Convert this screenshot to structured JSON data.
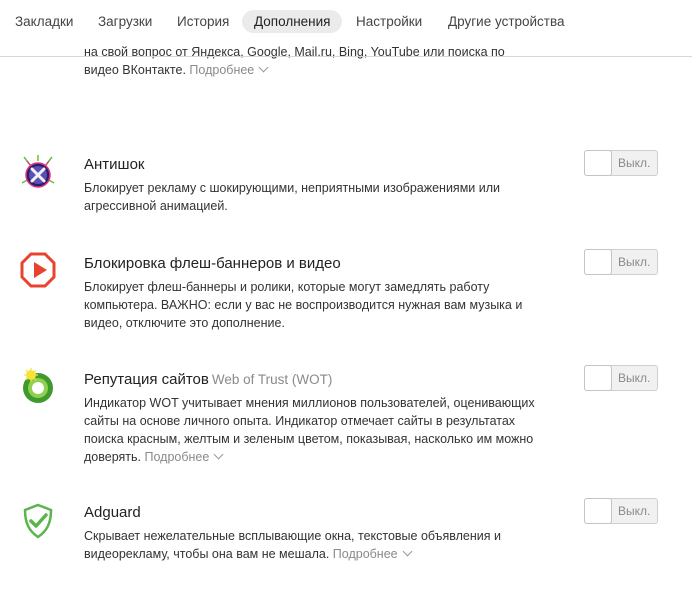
{
  "nav": {
    "tabs": [
      {
        "label": "Закладки",
        "active": false
      },
      {
        "label": "Загрузки",
        "active": false
      },
      {
        "label": "История",
        "active": false
      },
      {
        "label": "Дополнения",
        "active": true
      },
      {
        "label": "Настройки",
        "active": false
      },
      {
        "label": "Другие устройства",
        "active": false
      }
    ]
  },
  "previous_item": {
    "desc_line1": "на свой вопрос от Яндекса, Google, Mail.ru, Bing, YouTube или поиска по",
    "desc_line2": "видео ВКонтакте.",
    "more_label": "Подробнее"
  },
  "addons": [
    {
      "icon": "antishock-icon",
      "title": "Антишок",
      "subtitle": "",
      "description": "Блокирует рекламу с шокирующими, неприятными изображениями или агрессивной анимацией.",
      "more_label": "",
      "toggle_label": "Выкл.",
      "enabled": false
    },
    {
      "icon": "flash-block-icon",
      "title": "Блокировка флеш-баннеров и видео",
      "subtitle": "",
      "description": "Блокирует флеш-баннеры и ролики, которые могут замедлять работу компьютера. ВАЖНО: если у вас не воспроизводится нужная вам музыка и видео, отключите это дополнение.",
      "more_label": "",
      "toggle_label": "Выкл.",
      "enabled": false
    },
    {
      "icon": "wot-icon",
      "title": "Репутация сайтов",
      "subtitle": "Web of Trust (WOT)",
      "description": "Индикатор WOT учитывает мнения миллионов пользователей, оценивающих сайты на основе личного опыта. Индикатор отмечает сайты в результатах поиска красным, желтым и зеленым цветом, показывая, насколько им можно доверять.",
      "more_label": "Подробнее",
      "toggle_label": "Выкл.",
      "enabled": false
    },
    {
      "icon": "adguard-shield-icon",
      "title": "Adguard",
      "subtitle": "",
      "description": "Скрывает нежелательные всплывающие окна, текстовые объявления и видеорекламу, чтобы она вам не мешала.",
      "more_label": "Подробнее",
      "toggle_label": "Выкл.",
      "enabled": false
    }
  ],
  "colors": {
    "active_tab_bg": "#ebebeb",
    "muted_text": "#8a8a8a",
    "flash_icon_red": "#e8432e",
    "adguard_green": "#5ab54b",
    "wot_green": "#3f9a2e"
  }
}
